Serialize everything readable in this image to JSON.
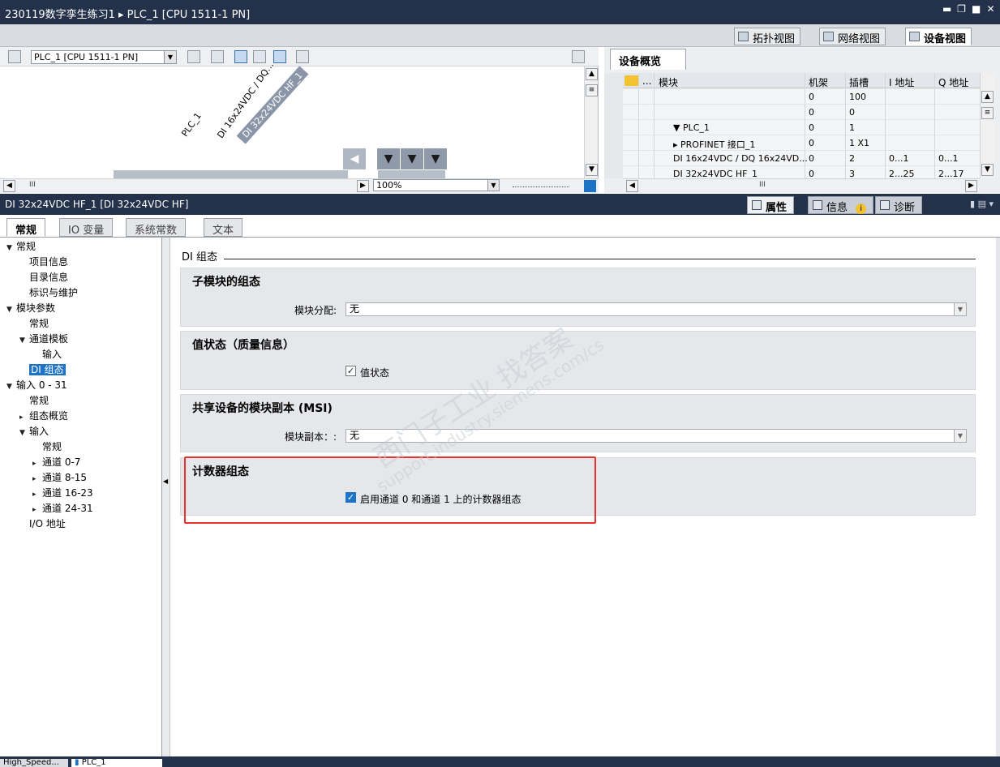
{
  "window": {
    "title": "230119数字孪生练习1 ▸ PLC_1 [CPU 1511-1 PN]",
    "controls": [
      "▬",
      "❐",
      "■",
      "✕"
    ]
  },
  "view_tabs": [
    "拓扑视图",
    "网络视图",
    "设备视图"
  ],
  "device_view": {
    "device_select": "PLC_1 [CPU 1511-1 PN]",
    "labels": {
      "plc": "PLC_1",
      "module1": "DI 16x24VDC / DQ...",
      "module2": "DI 32x24VDC HF_1"
    },
    "zoom": "100%",
    "scroll_mark": "III"
  },
  "overview": {
    "tab": "设备概览",
    "columns": [
      "模块",
      "机架",
      "插槽",
      "I 地址",
      "Q 地址"
    ],
    "col_ellipsis": "...",
    "rows": [
      {
        "module": "",
        "rack": "0",
        "slot": "100",
        "i": "",
        "q": ""
      },
      {
        "module": "",
        "rack": "0",
        "slot": "0",
        "i": "",
        "q": ""
      },
      {
        "module": "▼  PLC_1",
        "rack": "0",
        "slot": "1",
        "i": "",
        "q": ""
      },
      {
        "module": "▸  PROFINET 接口_1",
        "rack": "0",
        "slot": "1 X1",
        "i": "",
        "q": ""
      },
      {
        "module": "DI 16x24VDC / DQ 16x24VD...",
        "rack": "0",
        "slot": "2",
        "i": "0...1",
        "q": "0...1"
      },
      {
        "module": "DI 32x24VDC HF_1",
        "rack": "0",
        "slot": "3",
        "i": "2...25",
        "q": "2...17"
      }
    ]
  },
  "inspector": {
    "title": "DI 32x24VDC HF_1 [DI 32x24VDC HF]",
    "tabs": [
      "属性",
      "信息",
      "诊断"
    ],
    "info_badge": "i",
    "property_tabs": [
      "常规",
      "IO 变量",
      "系统常数",
      "文本"
    ]
  },
  "nav": [
    {
      "label": "常规",
      "level": 0,
      "tri": "▼"
    },
    {
      "label": "项目信息",
      "level": 1,
      "tri": ""
    },
    {
      "label": "目录信息",
      "level": 1,
      "tri": ""
    },
    {
      "label": "标识与维护",
      "level": 1,
      "tri": ""
    },
    {
      "label": "模块参数",
      "level": 0,
      "tri": "▼"
    },
    {
      "label": "常规",
      "level": 1,
      "tri": ""
    },
    {
      "label": "通道模板",
      "level": 1,
      "tri": "▼"
    },
    {
      "label": "输入",
      "level": 2,
      "tri": ""
    },
    {
      "label": "DI 组态",
      "level": 1,
      "tri": "",
      "selected": true
    },
    {
      "label": "输入 0 - 31",
      "level": 0,
      "tri": "▼"
    },
    {
      "label": "常规",
      "level": 1,
      "tri": ""
    },
    {
      "label": "组态概览",
      "level": 1,
      "tri": "▸"
    },
    {
      "label": "输入",
      "level": 1,
      "tri": "▼"
    },
    {
      "label": "常规",
      "level": 2,
      "tri": ""
    },
    {
      "label": "通道 0-7",
      "level": 2,
      "tri": "▸"
    },
    {
      "label": "通道 8-15",
      "level": 2,
      "tri": "▸"
    },
    {
      "label": "通道 16-23",
      "level": 2,
      "tri": "▸"
    },
    {
      "label": "通道 24-31",
      "level": 2,
      "tri": "▸"
    },
    {
      "label": "I/O 地址",
      "level": 1,
      "tri": ""
    }
  ],
  "content": {
    "section_title": "DI 组态",
    "groups": {
      "submodule": {
        "title": "子模块的组态",
        "field_label": "模块分配:",
        "value": "无"
      },
      "value_status": {
        "title": "值状态（质量信息）",
        "checkbox_label": "值状态",
        "checked": true
      },
      "msi": {
        "title": "共享设备的模块副本 (MSI)",
        "field_label": "模块副本：:",
        "value": "无"
      },
      "counter": {
        "title": "计数器组态",
        "checkbox_label": "启用通道 0 和通道 1 上的计数器组态",
        "checked": true
      }
    },
    "highlight_color": "#e8322f"
  },
  "watermark": {
    "line1": "西门子工业  找答案",
    "line2": "support.industry.siemens.com/cs"
  },
  "footer": {
    "tabs": [
      "High_Speed...",
      "PLC_1"
    ]
  }
}
